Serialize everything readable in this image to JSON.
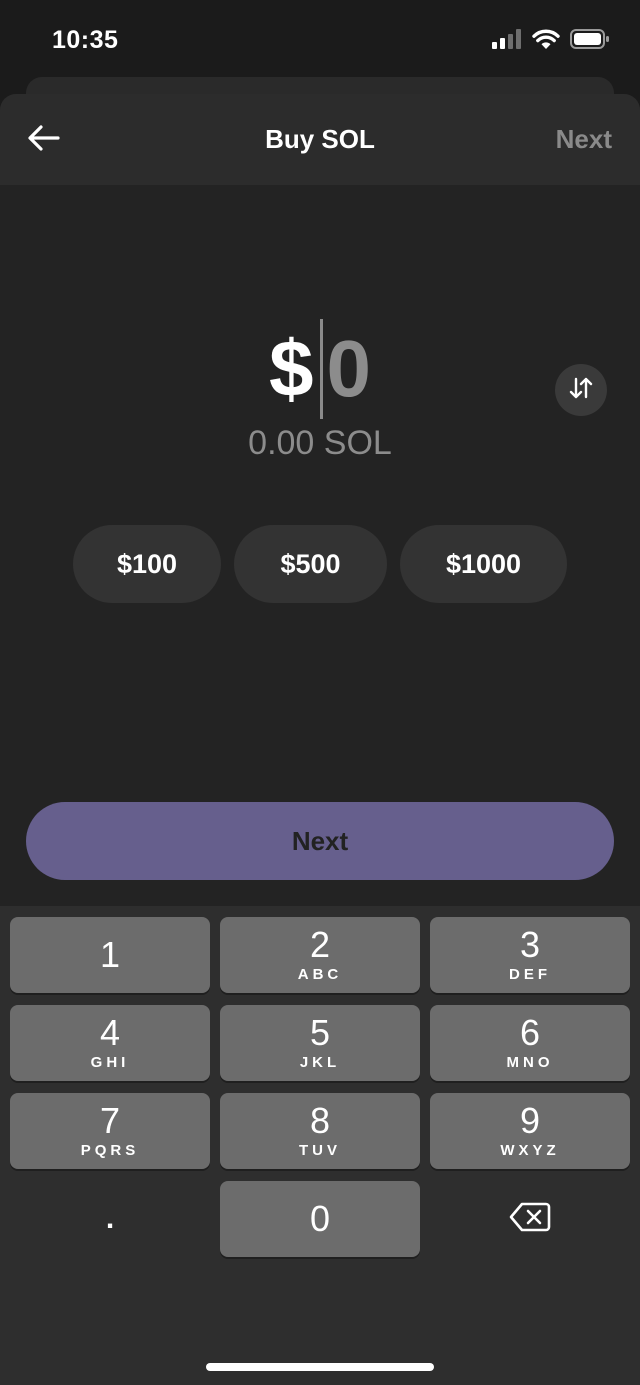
{
  "status_bar": {
    "time": "10:35",
    "icons": [
      "cellular-signal-icon",
      "wifi-icon",
      "battery-icon"
    ]
  },
  "header": {
    "back_icon": "arrow-left-icon",
    "title": "Buy SOL",
    "next_label": "Next"
  },
  "amount": {
    "currency_symbol": "$",
    "value": "0",
    "converted": "0.00 SOL",
    "swap_icon": "swap-arrows-icon"
  },
  "presets": [
    {
      "label": "$100"
    },
    {
      "label": "$500"
    },
    {
      "label": "$1000"
    }
  ],
  "primary_button": {
    "label": "Next"
  },
  "keypad": {
    "keys": [
      {
        "digit": "1",
        "letters": ""
      },
      {
        "digit": "2",
        "letters": "ABC"
      },
      {
        "digit": "3",
        "letters": "DEF"
      },
      {
        "digit": "4",
        "letters": "GHI"
      },
      {
        "digit": "5",
        "letters": "JKL"
      },
      {
        "digit": "6",
        "letters": "MNO"
      },
      {
        "digit": "7",
        "letters": "PQRS"
      },
      {
        "digit": "8",
        "letters": "TUV"
      },
      {
        "digit": "9",
        "letters": "WXYZ"
      },
      {
        "digit": "0",
        "letters": ""
      }
    ],
    "decimal_label": ".",
    "backspace_icon": "backspace-icon"
  },
  "colors": {
    "background": "#1b1b1b",
    "sheet": "#232323",
    "header": "#2c2c2c",
    "accent": "#665f8d",
    "chip": "#333333",
    "key": "#6c6c6c",
    "keypad_background": "#2e2e2e",
    "muted_text": "#8c8c8c"
  }
}
